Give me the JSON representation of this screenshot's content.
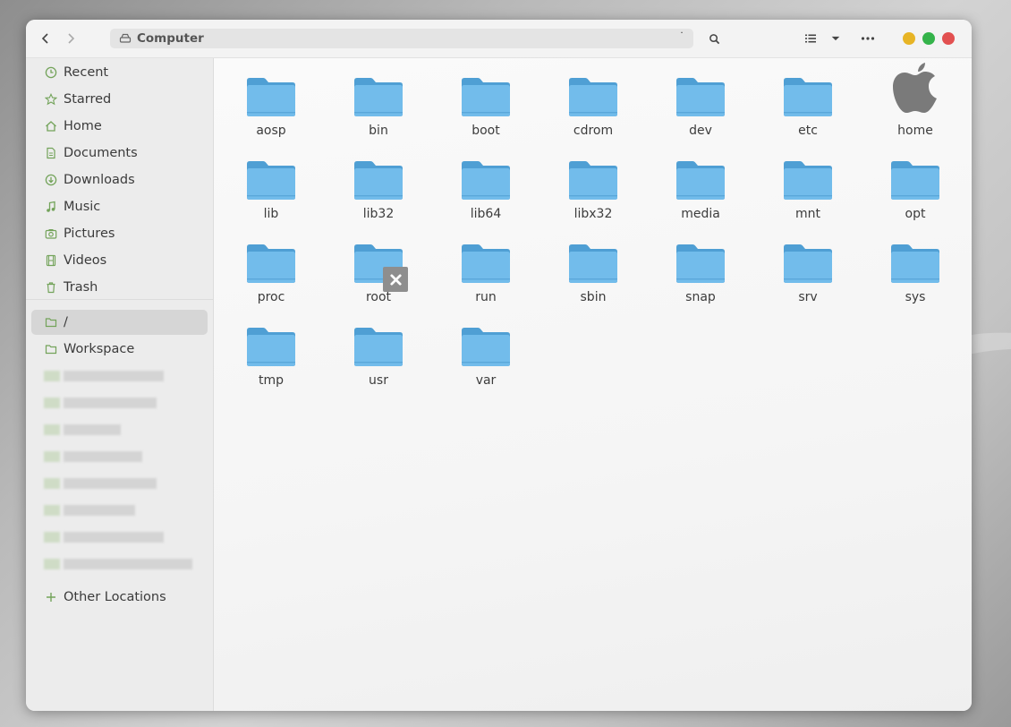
{
  "window": {
    "path_label": "Computer",
    "accent_colors": {
      "minimize": "#e7b425",
      "maximize": "#34b34a",
      "close": "#e25050",
      "folder": "#6cb6e6",
      "sidebar_icon": "#73a35a"
    }
  },
  "sidebar": {
    "items": [
      {
        "label": "Recent",
        "icon": "clock-icon"
      },
      {
        "label": "Starred",
        "icon": "star-icon"
      },
      {
        "label": "Home",
        "icon": "home-icon"
      },
      {
        "label": "Documents",
        "icon": "document-icon"
      },
      {
        "label": "Downloads",
        "icon": "download-icon"
      },
      {
        "label": "Music",
        "icon": "music-icon"
      },
      {
        "label": "Pictures",
        "icon": "camera-icon"
      },
      {
        "label": "Videos",
        "icon": "film-icon"
      },
      {
        "label": "Trash",
        "icon": "trash-icon"
      }
    ],
    "bookmarks": [
      {
        "label": "/",
        "icon": "folder-icon",
        "active": true
      },
      {
        "label": "Workspace",
        "icon": "folder-icon",
        "active": false
      }
    ],
    "other_locations": "Other Locations"
  },
  "files": [
    {
      "name": "aosp",
      "type": "folder"
    },
    {
      "name": "bin",
      "type": "folder"
    },
    {
      "name": "boot",
      "type": "folder"
    },
    {
      "name": "cdrom",
      "type": "folder"
    },
    {
      "name": "dev",
      "type": "folder"
    },
    {
      "name": "etc",
      "type": "folder"
    },
    {
      "name": "home",
      "type": "apple-home"
    },
    {
      "name": "lib",
      "type": "folder"
    },
    {
      "name": "lib32",
      "type": "folder"
    },
    {
      "name": "lib64",
      "type": "folder"
    },
    {
      "name": "libx32",
      "type": "folder"
    },
    {
      "name": "media",
      "type": "folder"
    },
    {
      "name": "mnt",
      "type": "folder"
    },
    {
      "name": "opt",
      "type": "folder"
    },
    {
      "name": "proc",
      "type": "folder"
    },
    {
      "name": "root",
      "type": "folder-locked"
    },
    {
      "name": "run",
      "type": "folder"
    },
    {
      "name": "sbin",
      "type": "folder"
    },
    {
      "name": "snap",
      "type": "folder"
    },
    {
      "name": "srv",
      "type": "folder"
    },
    {
      "name": "sys",
      "type": "folder"
    },
    {
      "name": "tmp",
      "type": "folder"
    },
    {
      "name": "usr",
      "type": "folder"
    },
    {
      "name": "var",
      "type": "folder"
    }
  ]
}
